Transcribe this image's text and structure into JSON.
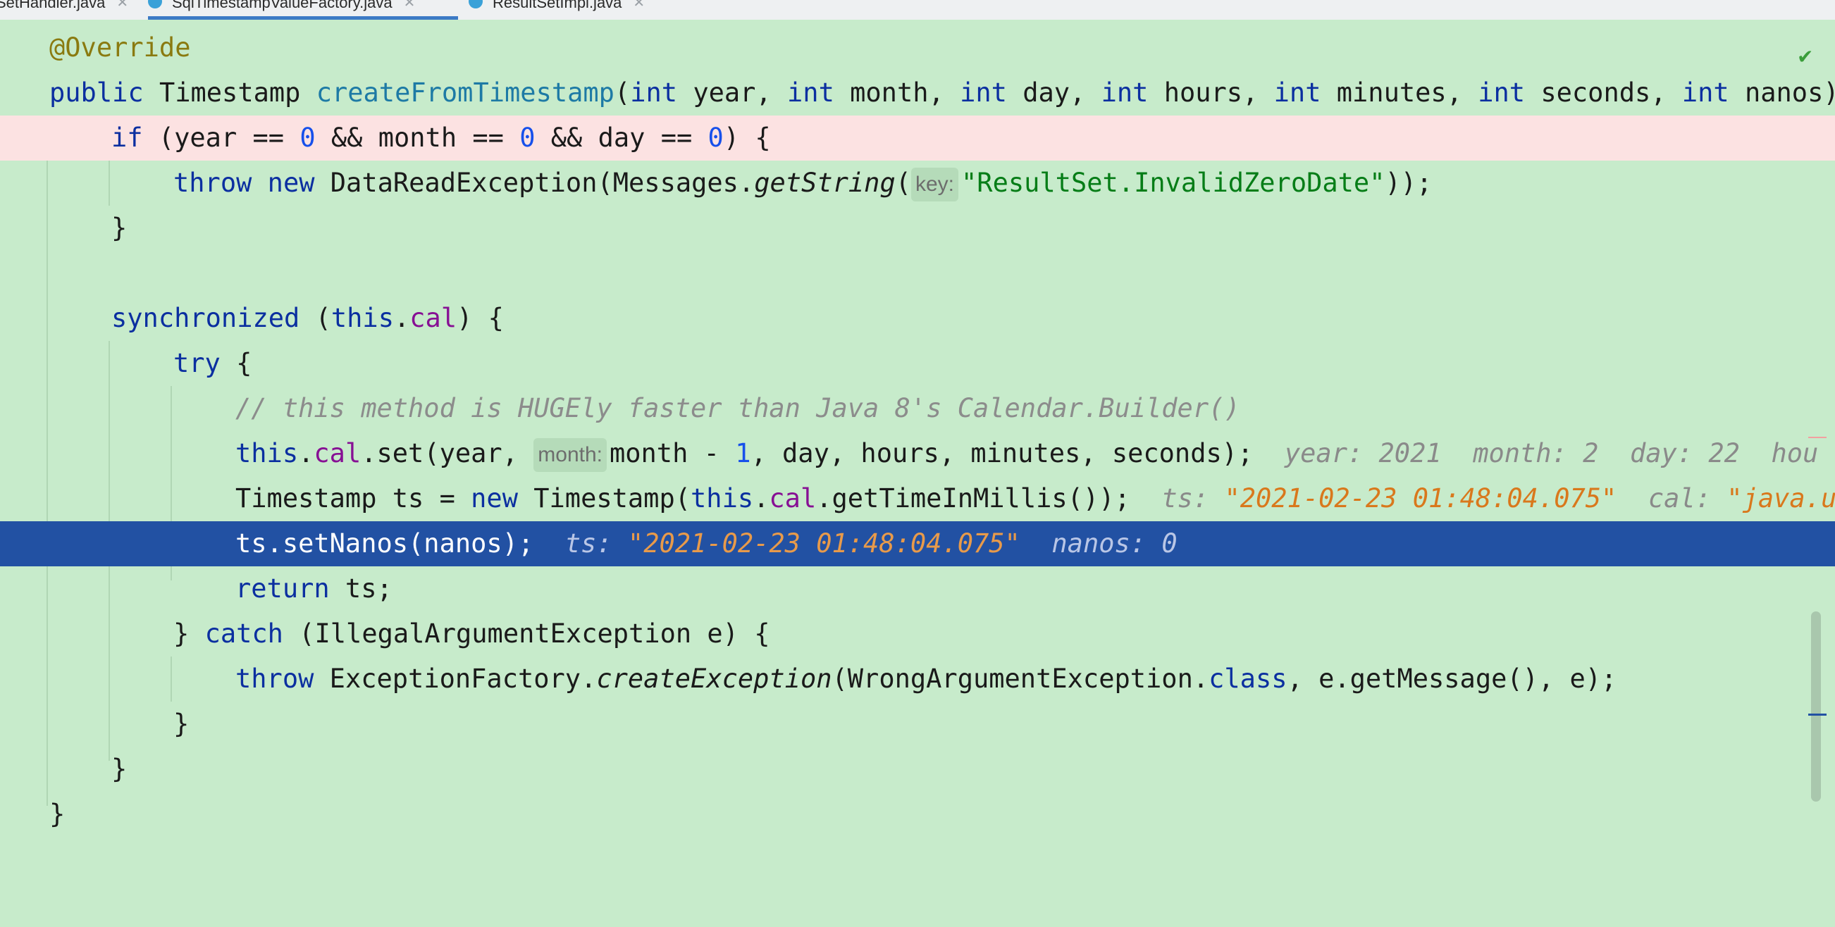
{
  "tabs": [
    {
      "label": "SetHandler.java",
      "active": false
    },
    {
      "label": "SqlTimestampValueFactory.java",
      "active": true
    },
    {
      "label": "ResultSetImpl.java",
      "active": false
    }
  ],
  "code": {
    "annotation": "@Override",
    "sig": {
      "public": "public",
      "type": "Timestamp",
      "method": "createFromTimestamp",
      "p1t": "int",
      "p1": "year",
      "p2t": "int",
      "p2": "month",
      "p3t": "int",
      "p3": "day",
      "p4t": "int",
      "p4": "hours",
      "p5t": "int",
      "p5": "minutes",
      "p6t": "int",
      "p6": "seconds",
      "p7t": "int",
      "p7": "nanos"
    },
    "if_kw": "if",
    "if_a": " (year == ",
    "if_n1": "0",
    "if_b": " && month == ",
    "if_n2": "0",
    "if_c": " && day == ",
    "if_n3": "0",
    "if_d": ") {",
    "throw1": {
      "kw1": "throw",
      "kw2": "new",
      "a": " DataReadException(Messages.",
      "m": "getString",
      "b": "(",
      "hint": "key:",
      "str": "\"ResultSet.InvalidZeroDate\"",
      "c": "));"
    },
    "close1": "}",
    "sync": {
      "kw": "synchronized",
      "a": " (",
      "this": "this",
      "dot": ".",
      "fld": "cal",
      "b": ") {"
    },
    "try_kw": "try",
    "try_b": " {",
    "comment": "// this method is HUGEly faster than Java 8's Calendar.Builder()",
    "set_line": {
      "this": "this",
      "dot1": ".",
      "fld": "cal",
      "a": ".set(year, ",
      "hint": "month:",
      "b": "month - ",
      "num": "1",
      "c": ", day, hours, minutes, seconds);",
      "dbg1k": "year: ",
      "dbg1v": "2021",
      "dbg2k": "month: ",
      "dbg2v": "2",
      "dbg3k": "day: ",
      "dbg3v": "22",
      "dbg4k": "hou"
    },
    "ts_line": {
      "a": "Timestamp ts = ",
      "kw": "new",
      "b": " Timestamp(",
      "this": "this",
      "dot": ".",
      "fld": "cal",
      "c": ".getTimeInMillis());",
      "dbg1k": "ts: ",
      "dbg1v": "\"2021-02-23 01:48:04.075\"",
      "dbg2k": "cal: ",
      "dbg2v": "\"java.ut"
    },
    "nanos_line": {
      "a": "ts.setNanos(nanos);",
      "dbg1k": "ts: ",
      "dbg1v": "\"2021-02-23 01:48:04.075\"",
      "dbg2k": "nanos: ",
      "dbg2v": "0"
    },
    "return_kw": "return",
    "return_b": " ts;",
    "catch_line": {
      "a": "} ",
      "kw": "catch",
      "b": " (IllegalArgumentException e) {"
    },
    "throw2": {
      "kw": "throw",
      "a": " ExceptionFactory.",
      "m": "createException",
      "b": "(WrongArgumentException.",
      "cls": "class",
      "c": ", e.getMessage(), e);"
    },
    "close_inner": "}",
    "close_sync": "}",
    "close_method": "}"
  }
}
